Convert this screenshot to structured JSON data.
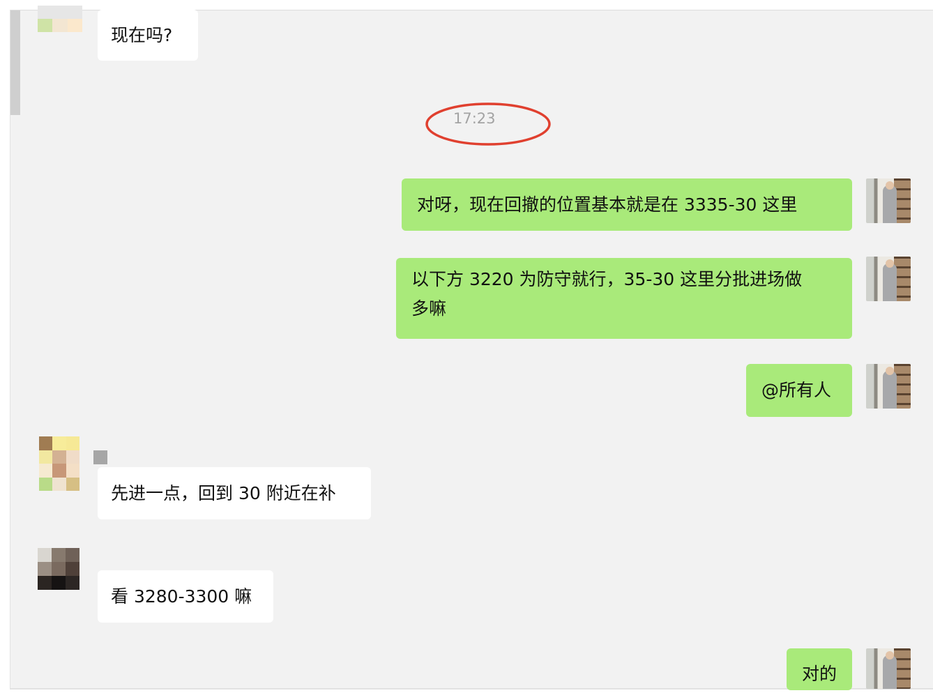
{
  "chat": {
    "timestamp": "17:23",
    "messages": [
      {
        "id": "m1",
        "side": "in",
        "text": "现在吗?"
      },
      {
        "id": "m2",
        "side": "out",
        "text": "对呀，现在回撤的位置基本就是在 3335-30 这里"
      },
      {
        "id": "m3",
        "side": "out",
        "lines": [
          "以下方 3220 为防守就行，35-30 这里分批进场做",
          "多嘛"
        ]
      },
      {
        "id": "m4",
        "side": "out",
        "text": "@所有人"
      },
      {
        "id": "m5",
        "side": "in",
        "text": "先进一点，回到 30 附近在补"
      },
      {
        "id": "m6",
        "side": "in",
        "text": "看 3280-3300 嘛"
      },
      {
        "id": "m7",
        "side": "out",
        "text": "对的"
      }
    ]
  },
  "colors": {
    "outgoing_bubble": "#a9ea7a",
    "incoming_bubble": "#ffffff",
    "chat_background": "#f2f2f2",
    "annotation_circle": "#e0402f"
  },
  "icons": {
    "self_avatar": "avatar-self",
    "pixelated_avatar": "avatar-pixelated"
  }
}
